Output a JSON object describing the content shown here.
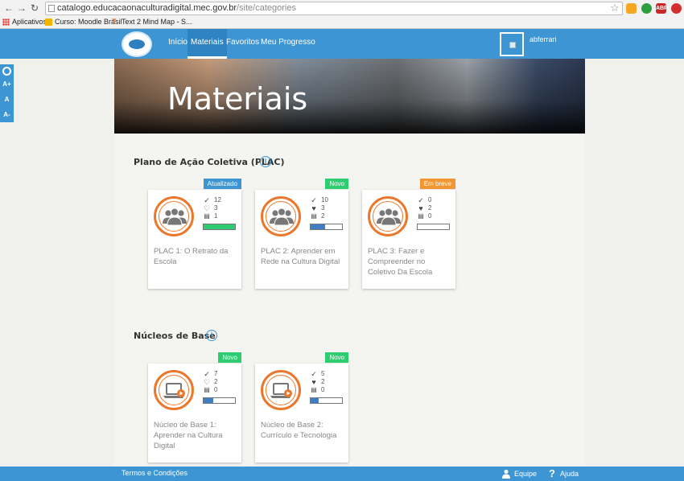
{
  "browser": {
    "url_host": "catalogo.educacaonaculturadigital.mec.gov.br",
    "url_path": "/site/categories",
    "bookmarks": [
      {
        "label": "Aplicativos"
      },
      {
        "label": "Curso: Moodle Brasil"
      },
      {
        "label": "Text 2 Mind Map - S..."
      }
    ],
    "ext_abp": "ABP"
  },
  "header": {
    "nav": [
      "Início",
      "Materiais",
      "Favoritos",
      "Meu Progresso"
    ],
    "active": "Materiais",
    "username": "abferrari"
  },
  "accessibility": {
    "items": [
      "A+",
      "A",
      "A-"
    ]
  },
  "hero": {
    "title": "Materiais"
  },
  "sections": [
    {
      "title": "Plano de Ação Coletiva (PLAC)",
      "cards": [
        {
          "badge": "Atualizado",
          "badge_color": "#3d95d3",
          "icon": "people-group-icon",
          "stats": {
            "completed": "12",
            "favorites": "3",
            "rating": "1"
          },
          "favorited": false,
          "progress": 1.0,
          "progress_color": "#2ecc71",
          "title": "PLAC 1: O Retrato da Escola"
        },
        {
          "badge": "Novo",
          "badge_color": "#2ecc71",
          "icon": "people-group-icon",
          "stats": {
            "completed": "10",
            "favorites": "3",
            "rating": "2"
          },
          "favorited": true,
          "progress": 0.45,
          "progress_color": "#3d7fc0",
          "title": "PLAC 2: Aprender em Rede na Cultura Digital"
        },
        {
          "badge": "Em breve",
          "badge_color": "#f29633",
          "icon": "people-group-icon",
          "stats": {
            "completed": "0",
            "favorites": "2",
            "rating": "0"
          },
          "favorited": true,
          "progress": 0.0,
          "progress_color": "#3d7fc0",
          "title": "PLAC 3: Fazer e Compreender no Coletivo Da Escola"
        }
      ]
    },
    {
      "title": "Núcleos de Base",
      "cards": [
        {
          "badge": "Novo",
          "badge_color": "#2ecc71",
          "icon": "laptop-play-icon",
          "stats": {
            "completed": "7",
            "favorites": "2",
            "rating": "0"
          },
          "favorited": false,
          "progress": 0.3,
          "progress_color": "#3d7fc0",
          "title": "Núcleo de Base 1: Aprender na Cultura Digital"
        },
        {
          "badge": "Novo",
          "badge_color": "#2ecc71",
          "icon": "laptop-play-icon",
          "stats": {
            "completed": "5",
            "favorites": "2",
            "rating": "0"
          },
          "favorited": true,
          "progress": 0.25,
          "progress_color": "#3d7fc0",
          "title": "Núcleo de Base 2: Currículo e Tecnologia"
        }
      ]
    }
  ],
  "footer": {
    "terms": "Termos e Condições",
    "team": "Equipe",
    "help": "Ajuda"
  }
}
